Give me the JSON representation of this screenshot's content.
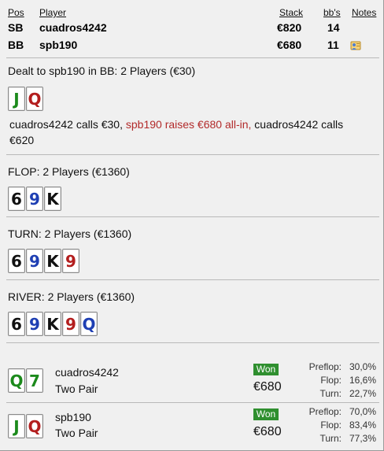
{
  "header": {
    "col_pos": "Pos",
    "col_player": "Player",
    "col_stack": "Stack",
    "col_bbs": "bb's",
    "col_notes": "Notes"
  },
  "players": [
    {
      "pos": "SB",
      "name": "cuadros4242",
      "stack": "€820",
      "bbs": "14",
      "has_note": false
    },
    {
      "pos": "BB",
      "name": "spb190",
      "stack": "€680",
      "bbs": "11",
      "has_note": true
    }
  ],
  "preflop": {
    "title": "Dealt to spb190 in BB: 2 Players (€30)",
    "hero_cards": [
      {
        "rank": "J",
        "suit_color": "green"
      },
      {
        "rank": "Q",
        "suit_color": "red"
      }
    ],
    "action_1": "cuadros4242 calls €30, ",
    "action_2_raise": "spb190 raises €680 all-in,",
    "action_3": " cuadros4242 calls €620"
  },
  "flop": {
    "title": "FLOP: 2 Players (€1360)",
    "cards": [
      {
        "rank": "6",
        "suit_color": "black"
      },
      {
        "rank": "9",
        "suit_color": "blue"
      },
      {
        "rank": "K",
        "suit_color": "black"
      }
    ]
  },
  "turn": {
    "title": "TURN: 2 Players (€1360)",
    "cards": [
      {
        "rank": "6",
        "suit_color": "black"
      },
      {
        "rank": "9",
        "suit_color": "blue"
      },
      {
        "rank": "K",
        "suit_color": "black"
      },
      {
        "rank": "9",
        "suit_color": "red"
      }
    ]
  },
  "river": {
    "title": "RIVER: 2 Players (€1360)",
    "cards": [
      {
        "rank": "6",
        "suit_color": "black"
      },
      {
        "rank": "9",
        "suit_color": "blue"
      },
      {
        "rank": "K",
        "suit_color": "black"
      },
      {
        "rank": "9",
        "suit_color": "red"
      },
      {
        "rank": "Q",
        "suit_color": "blue"
      }
    ]
  },
  "results": [
    {
      "name": "cuadros4242",
      "hand": "Two Pair",
      "cards": [
        {
          "rank": "Q",
          "suit_color": "green"
        },
        {
          "rank": "7",
          "suit_color": "green"
        }
      ],
      "won_label": "Won",
      "amount": "€680",
      "preflop_label": "Preflop:",
      "preflop": "30,0%",
      "flop_label": "Flop:",
      "flop": "16,6%",
      "turn_label": "Turn:",
      "turn": "22,7%"
    },
    {
      "name": "spb190",
      "hand": "Two Pair",
      "cards": [
        {
          "rank": "J",
          "suit_color": "green"
        },
        {
          "rank": "Q",
          "suit_color": "red"
        }
      ],
      "won_label": "Won",
      "amount": "€680",
      "preflop_label": "Preflop:",
      "preflop": "70,0%",
      "flop_label": "Flop:",
      "flop": "83,4%",
      "turn_label": "Turn:",
      "turn": "77,3%"
    }
  ],
  "colors": {
    "green": "#1c8a1c",
    "red": "#b31e1e",
    "black": "#111111",
    "blue": "#1e3fb3",
    "won_badge": "#2f8f2f",
    "raise_text": "#b22a2a"
  },
  "icons": {
    "note": "user-note-icon"
  }
}
